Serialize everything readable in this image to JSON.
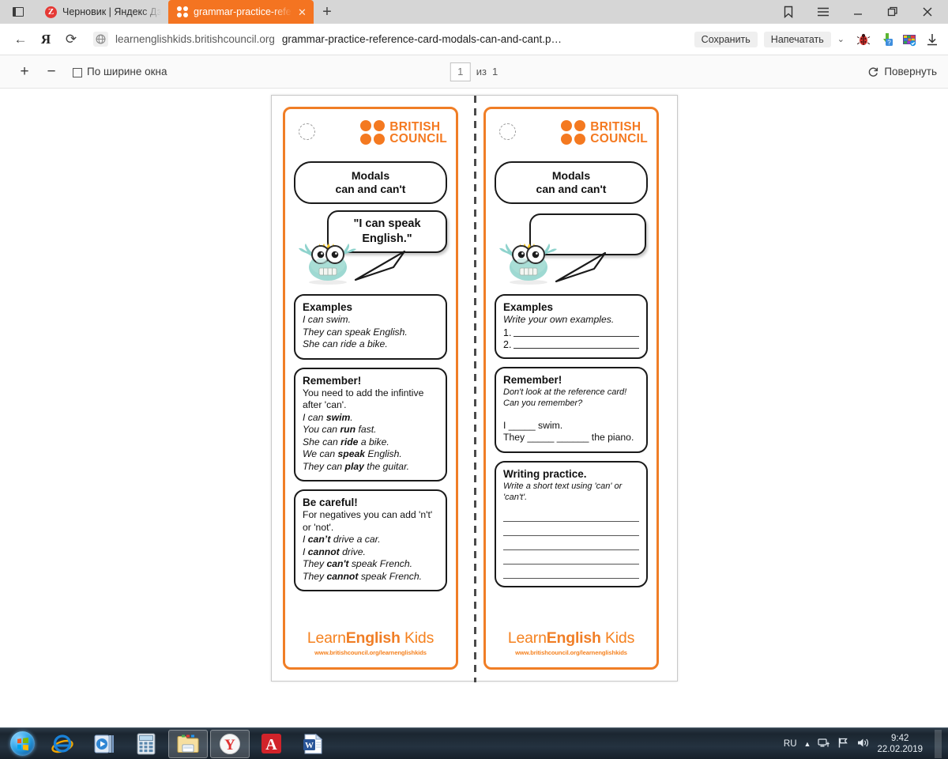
{
  "browser": {
    "sidebar_icon": "sidebar-panel-icon",
    "tabs": [
      {
        "title": "Черновик | Яндекс Дзен",
        "favicon": "yandex-zen-favicon",
        "active": false
      },
      {
        "title": "grammar-practice-refere",
        "favicon": "british-council-favicon",
        "active": true,
        "close_label": "✕"
      }
    ],
    "new_tab_label": "+",
    "window_controls": {
      "bookmark": "🔖",
      "menu": "☰",
      "minimize": "—",
      "maximize": "❐",
      "close": "✕"
    },
    "nav": {
      "back": "←",
      "yandex": "Я",
      "reload": "⟳"
    },
    "omnibox": {
      "host": "learnenglishkids.britishcouncil.org",
      "path": "grammar-practice-reference-card-modals-can-and-cant.p…"
    },
    "actions": {
      "save": "Сохранить",
      "print": "Напечатать",
      "more": "⌄"
    },
    "extensions": [
      "bug-icon",
      "download-helper-icon",
      "archiver-icon",
      "download-icon"
    ]
  },
  "pdf_toolbar": {
    "zoom_in": "+",
    "zoom_out": "−",
    "fit_label": "По ширине окна",
    "page_current": "1",
    "page_total_prefix": "из",
    "page_total": "1",
    "rotate_label": "Повернуть"
  },
  "document": {
    "cards": [
      {
        "side": "reference",
        "logo_text_line1": "BRITISH",
        "logo_text_line2": "COUNCIL",
        "title_line1": "Modals",
        "title_line2": "can and can't",
        "bubble_text": "\"I can speak English.\"",
        "boxes": [
          {
            "heading": "Examples",
            "lines": [
              {
                "text": "I can swim.",
                "style": "italic"
              },
              {
                "text": "They can speak English.",
                "style": "italic"
              },
              {
                "text": "She can ride a bike.",
                "style": "italic"
              }
            ]
          },
          {
            "heading": "Remember!",
            "lines": [
              {
                "text": "You need to add the infintive after 'can'.",
                "style": "plain"
              },
              {
                "html": "I can <b>swim</b>.",
                "style": "italic"
              },
              {
                "html": "You can <b>run</b> fast.",
                "style": "italic"
              },
              {
                "html": "She can <b>ride</b> a bike.",
                "style": "italic"
              },
              {
                "html": "We can <b>speak</b> English.",
                "style": "italic"
              },
              {
                "html": "They can <b>play</b> the guitar.",
                "style": "italic"
              }
            ]
          },
          {
            "heading": "Be careful!",
            "lines": [
              {
                "text": "For negatives you can add 'n't' or 'not'.",
                "style": "plain"
              },
              {
                "html": "I <b>can’t</b> drive a car.",
                "style": "italic"
              },
              {
                "html": "I <b>cannot</b> drive.",
                "style": "italic"
              },
              {
                "html": "They <b>can't</b> speak French.",
                "style": "italic"
              },
              {
                "html": "They <b>cannot</b> speak French.",
                "style": "italic"
              }
            ]
          }
        ],
        "footer_brand_1": "Learn",
        "footer_brand_2": "English",
        "footer_brand_3": " Kids",
        "footer_url": "www.britishcouncil.org/learnenglishkids"
      },
      {
        "side": "practice",
        "logo_text_line1": "BRITISH",
        "logo_text_line2": "COUNCIL",
        "title_line1": "Modals",
        "title_line2": "can and can't",
        "bubble_text": "",
        "boxes": [
          {
            "heading": "Examples",
            "instruction": "Write your own examples.",
            "numbered_blanks": [
              "1.",
              "2."
            ]
          },
          {
            "heading": "Remember!",
            "instruction_1": "Don't look at the reference card!",
            "instruction_2": "Can you remember?",
            "gap_lines": [
              "I _____ swim.",
              "They _____ ______ the piano."
            ]
          },
          {
            "heading": "Writing practice.",
            "instruction": "Write a short text using 'can' or 'can't'.",
            "write_lines": 5
          }
        ],
        "footer_brand_1": "Learn",
        "footer_brand_2": "English",
        "footer_brand_3": " Kids",
        "footer_url": "www.britishcouncil.org/learnenglishkids"
      }
    ]
  },
  "taskbar": {
    "start_label": "start-orb",
    "items": [
      "internet-explorer-icon",
      "media-player-icon",
      "calculator-icon",
      "file-explorer-icon",
      "yandex-browser-icon",
      "adobe-acrobat-icon",
      "microsoft-word-icon"
    ],
    "tray": {
      "language": "RU",
      "show_hidden": "▲",
      "network_icon": "network-icon",
      "flag_icon": "action-center-flag-icon",
      "volume_icon": "volume-icon",
      "time": "9:42",
      "date": "22.02.2019"
    }
  },
  "colors": {
    "brand_orange": "#f47920",
    "card_border": "#f07e26",
    "tab_active": "#f47421",
    "taskbar": "#1b2630"
  }
}
